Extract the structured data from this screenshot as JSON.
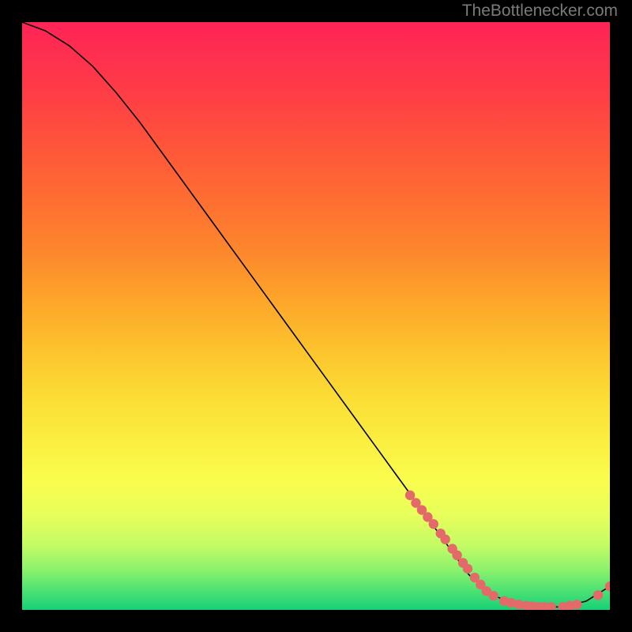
{
  "attribution": "TheBottlenecker.com",
  "chart_data": {
    "type": "line",
    "title": "",
    "xlabel": "",
    "ylabel": "",
    "xlim": [
      0,
      100
    ],
    "ylim": [
      0,
      100
    ],
    "x": [
      0,
      4,
      8,
      12,
      16,
      20,
      24,
      28,
      32,
      36,
      40,
      44,
      48,
      52,
      56,
      60,
      64,
      68,
      72,
      76,
      80,
      84,
      88,
      92,
      96,
      100
    ],
    "y": [
      100,
      98.5,
      96,
      92.5,
      88,
      83,
      77.5,
      72,
      66.5,
      61,
      55.5,
      50,
      44.5,
      39,
      33.5,
      28,
      22.5,
      17,
      11.5,
      6,
      2.5,
      1,
      0.5,
      0.5,
      1.5,
      4
    ],
    "markers": [
      {
        "x": 66,
        "y": 19.5
      },
      {
        "x": 67,
        "y": 18.2
      },
      {
        "x": 68,
        "y": 17.0
      },
      {
        "x": 69,
        "y": 15.8
      },
      {
        "x": 70,
        "y": 14.6
      },
      {
        "x": 71.2,
        "y": 13.0
      },
      {
        "x": 72,
        "y": 12.0
      },
      {
        "x": 73.2,
        "y": 10.4
      },
      {
        "x": 74,
        "y": 9.3
      },
      {
        "x": 75,
        "y": 8.0
      },
      {
        "x": 75.8,
        "y": 7.0
      },
      {
        "x": 77,
        "y": 5.5
      },
      {
        "x": 78,
        "y": 4.3
      },
      {
        "x": 79,
        "y": 3.2
      },
      {
        "x": 80.2,
        "y": 2.4
      },
      {
        "x": 82,
        "y": 1.5
      },
      {
        "x": 83.2,
        "y": 1.2
      },
      {
        "x": 84.5,
        "y": 0.9
      },
      {
        "x": 85.8,
        "y": 0.7
      },
      {
        "x": 86.8,
        "y": 0.6
      },
      {
        "x": 87.8,
        "y": 0.5
      },
      {
        "x": 88.8,
        "y": 0.5
      },
      {
        "x": 90,
        "y": 0.5
      },
      {
        "x": 92,
        "y": 0.5
      },
      {
        "x": 93.2,
        "y": 0.7
      },
      {
        "x": 94.4,
        "y": 0.9
      },
      {
        "x": 98,
        "y": 2.5
      },
      {
        "x": 100,
        "y": 4.0
      }
    ],
    "gradient_stops": [
      {
        "offset": 0.0,
        "color": "#ff2457"
      },
      {
        "offset": 0.1,
        "color": "#fe3849"
      },
      {
        "offset": 0.2,
        "color": "#fe523b"
      },
      {
        "offset": 0.3,
        "color": "#fe6d32"
      },
      {
        "offset": 0.4,
        "color": "#fd8a2c"
      },
      {
        "offset": 0.48,
        "color": "#fda82a"
      },
      {
        "offset": 0.56,
        "color": "#fcc42d"
      },
      {
        "offset": 0.64,
        "color": "#fbdd35"
      },
      {
        "offset": 0.72,
        "color": "#fbf041"
      },
      {
        "offset": 0.78,
        "color": "#fafd4e"
      },
      {
        "offset": 0.84,
        "color": "#e7fe5b"
      },
      {
        "offset": 0.89,
        "color": "#c3fb65"
      },
      {
        "offset": 0.93,
        "color": "#8ef26c"
      },
      {
        "offset": 0.965,
        "color": "#50e372"
      },
      {
        "offset": 1.0,
        "color": "#18d077"
      }
    ]
  }
}
